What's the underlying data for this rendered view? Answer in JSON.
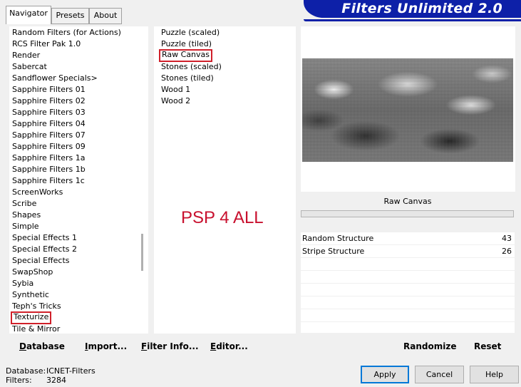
{
  "tabs": [
    {
      "label": "Navigator",
      "active": true
    },
    {
      "label": "Presets",
      "active": false
    },
    {
      "label": "About",
      "active": false
    }
  ],
  "banner": {
    "title": "Filters Unlimited 2.0",
    "color": "#0d20a8"
  },
  "categories": {
    "items": [
      "Random Filters (for Actions)",
      "RCS Filter Pak 1.0",
      "Render",
      "Sabercat",
      "Sandflower Specials>",
      "Sapphire Filters 01",
      "Sapphire Filters 02",
      "Sapphire Filters 03",
      "Sapphire Filters 04",
      "Sapphire Filters 07",
      "Sapphire Filters 09",
      "Sapphire Filters 1a",
      "Sapphire Filters 1b",
      "Sapphire Filters 1c",
      "ScreenWorks",
      "Scribe",
      "Shapes",
      "Simple",
      "Special Effects 1",
      "Special Effects 2",
      "Special Effects",
      "SwapShop",
      "Sybia",
      "Synthetic",
      "Teph's Tricks",
      "Texturize",
      "Tile & Mirror"
    ],
    "selected": "Texturize"
  },
  "filters": {
    "items": [
      "Puzzle (scaled)",
      "Puzzle (tiled)",
      "Raw Canvas",
      "Stones (scaled)",
      "Stones (tiled)",
      "Wood 1",
      "Wood 2"
    ],
    "selected": "Raw Canvas"
  },
  "watermark": "PSP 4 ALL",
  "preview": {
    "filter_name": "Raw Canvas"
  },
  "parameters": [
    {
      "label": "Random Structure",
      "value": "43"
    },
    {
      "label": "Stripe Structure",
      "value": "26"
    }
  ],
  "toolbar": {
    "database": {
      "u": "D",
      "rest": "atabase"
    },
    "import": {
      "u": "I",
      "rest": "mport..."
    },
    "filter_info": {
      "u": "F",
      "rest": "ilter Info..."
    },
    "editor": {
      "u": "E",
      "rest": "ditor..."
    },
    "randomize": "Randomize",
    "reset": "Reset"
  },
  "status": {
    "database_label": "Database:",
    "database_value": "ICNET-Filters",
    "filters_label": "Filters:",
    "filters_value": "3284"
  },
  "buttons": {
    "apply": "Apply",
    "cancel": "Cancel",
    "help": "Help"
  },
  "colors": {
    "selection_outline": "#d0202a",
    "watermark": "#c8102e"
  }
}
